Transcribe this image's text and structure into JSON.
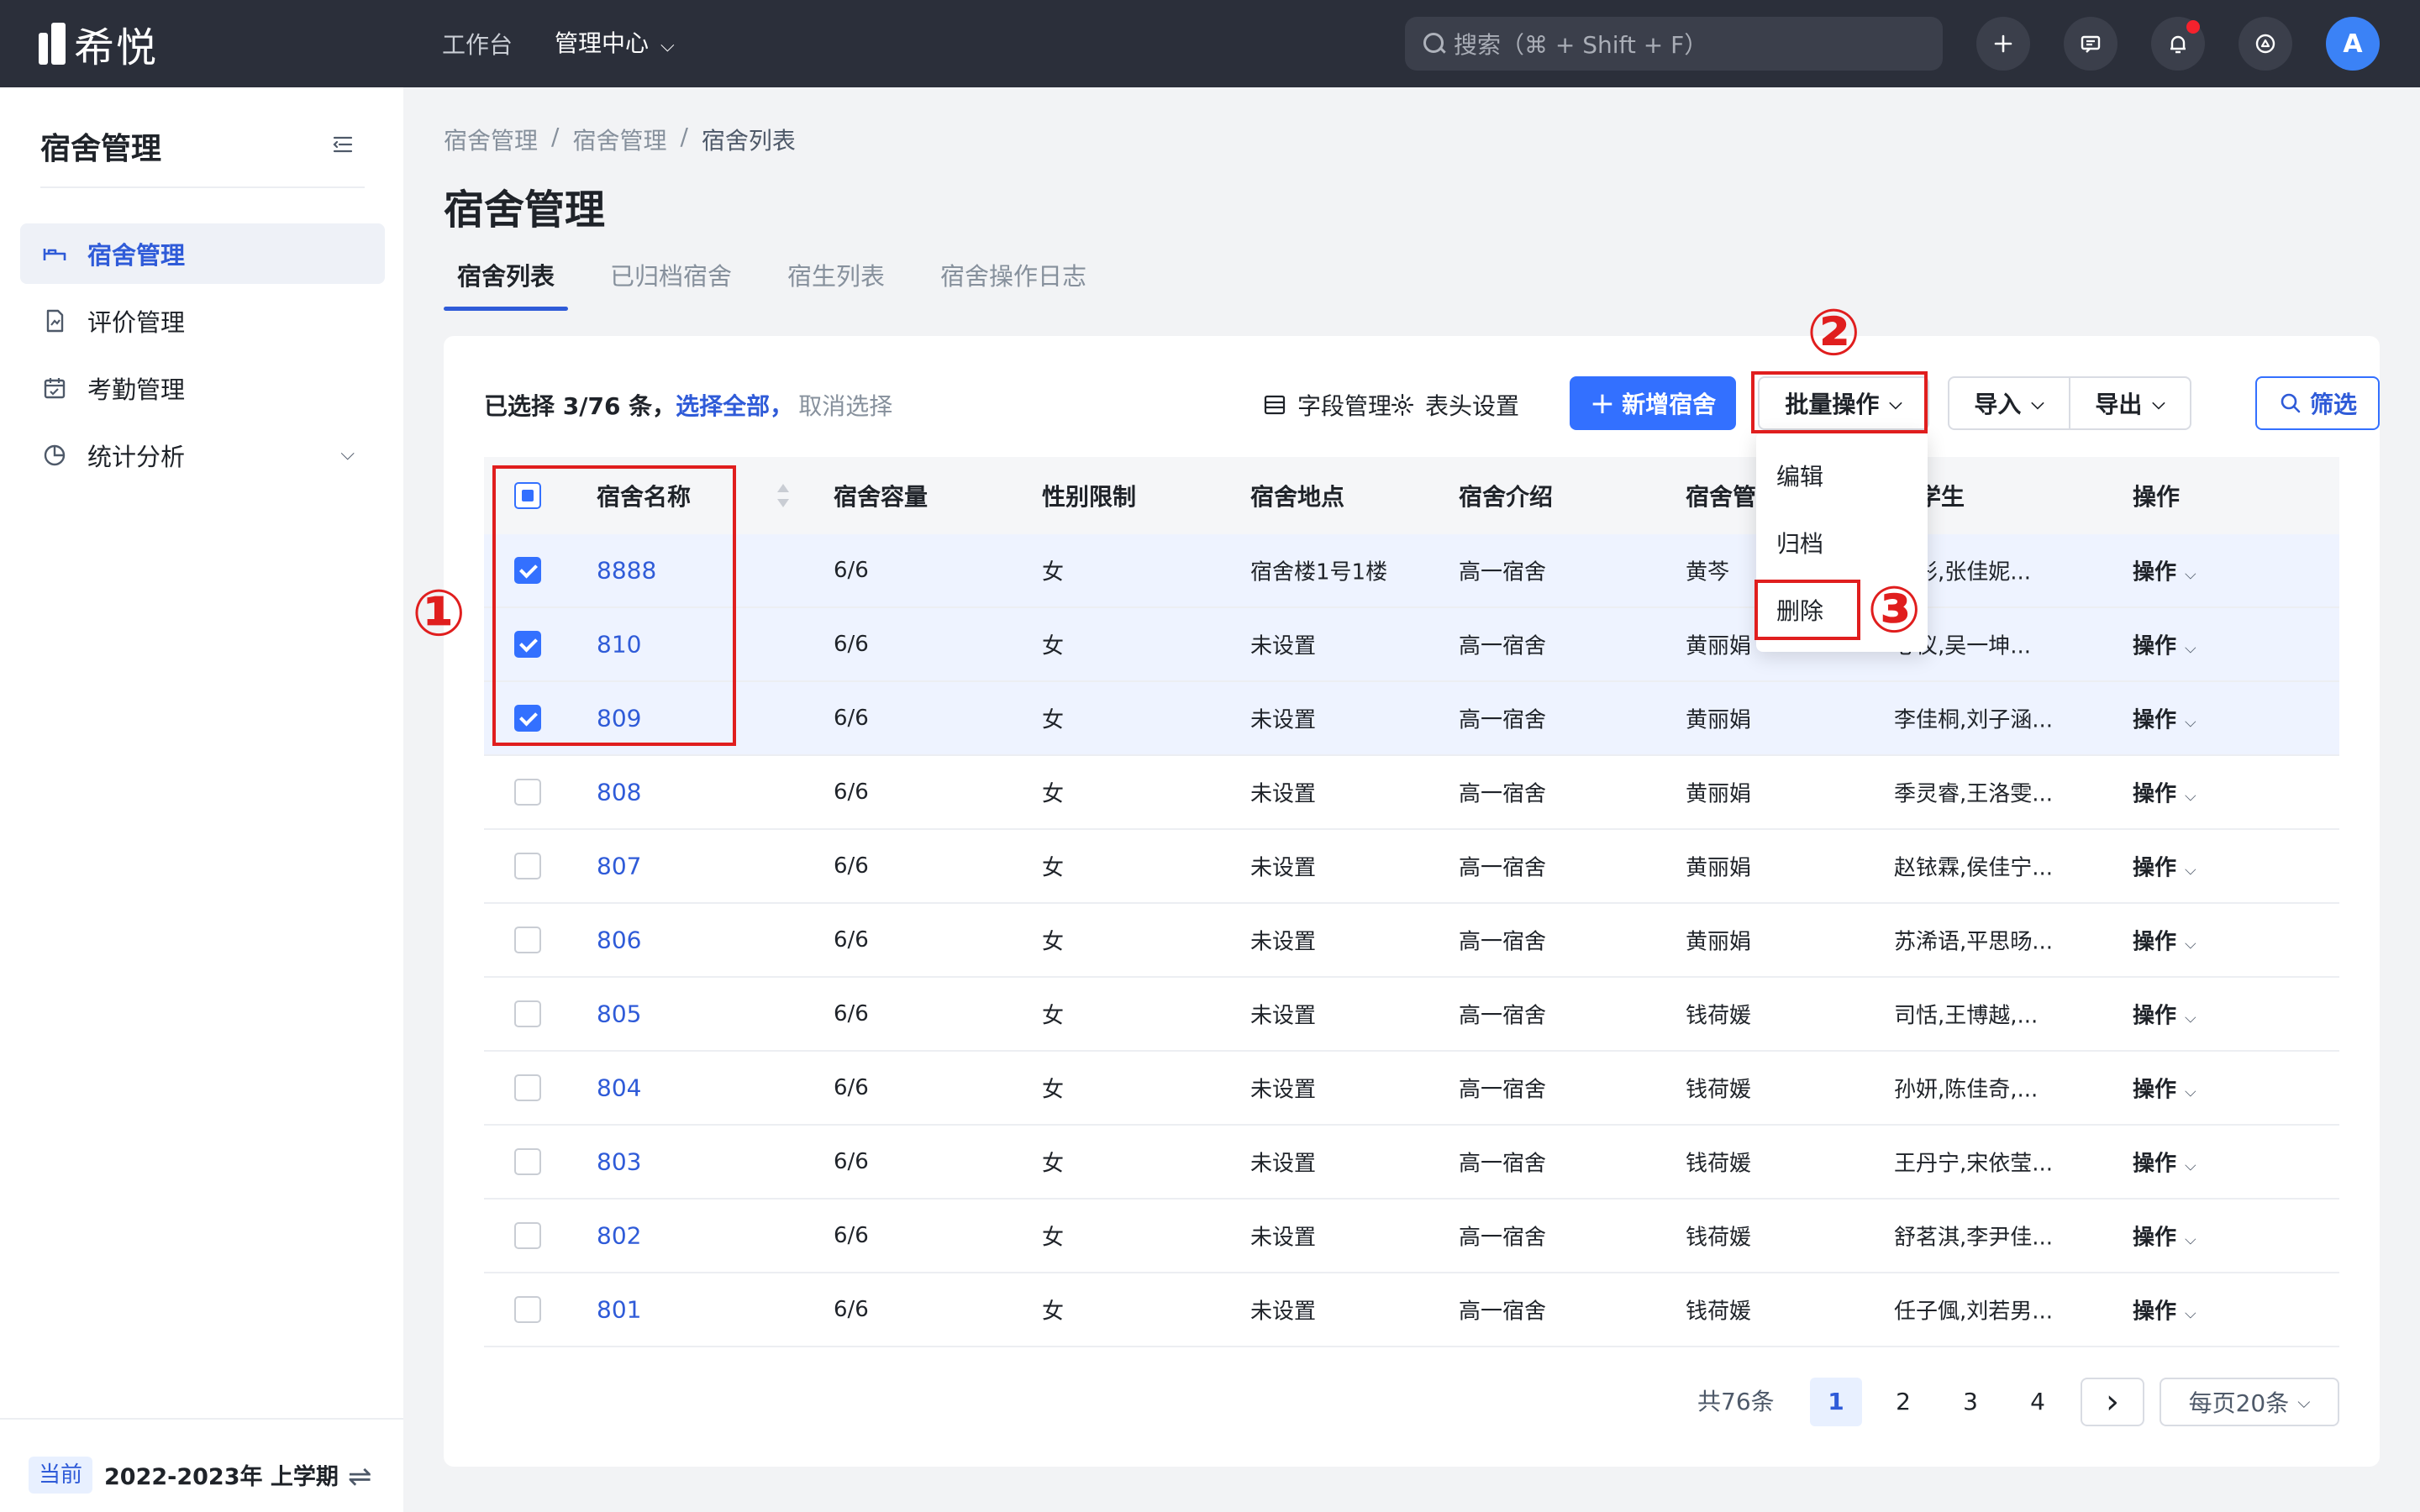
{
  "app": {
    "logo_text": "希悦"
  },
  "topnav": {
    "items": [
      "工作台",
      "管理中心"
    ],
    "chevron": "⌄"
  },
  "search": {
    "placeholder": "搜索（⌘ + Shift + F）"
  },
  "header_icons": [
    "plus-icon",
    "message-icon",
    "bell-icon",
    "help-icon"
  ],
  "user": {
    "avatar": "A"
  },
  "sidebar": {
    "title": "宿舍管理",
    "items": [
      {
        "label": "宿舍管理",
        "icon": "bed-icon"
      },
      {
        "label": "评价管理",
        "icon": "evaluation-icon"
      },
      {
        "label": "考勤管理",
        "icon": "calendar-icon"
      },
      {
        "label": "统计分析",
        "icon": "pie-chart-icon"
      }
    ],
    "term_tag": "当前",
    "term_text": "2022-2023年 上学期"
  },
  "breadcrumb": [
    "宿舍管理",
    "/",
    "宿舍管理",
    "/",
    "宿舍列表"
  ],
  "page_title": "宿舍管理",
  "tabs": [
    "宿舍列表",
    "已归档宿舍",
    "宿生列表",
    "宿舍操作日志"
  ],
  "toolbar": {
    "selection_prefix": "已选择 3/76 条，",
    "select_all": "选择全部，",
    "cancel": "取消选择",
    "field_manage": "字段管理",
    "header_settings": "表头设置",
    "add_plus": "+",
    "add_button": "新增宿舍",
    "batch_button": "批量操作",
    "import_button": "导入",
    "export_button": "导出",
    "filter_button": "筛选"
  },
  "batch_menu": [
    "编辑",
    "归档",
    "删除"
  ],
  "table": {
    "headers": [
      "宿舍名称",
      "宿舍容量",
      "性别限制",
      "宿舍地点",
      "宿舍介绍",
      "宿舍管",
      "舍学生",
      "操作"
    ],
    "rows": [
      {
        "name": "8888",
        "capacity": "6/6",
        "gender": "女",
        "location": "宿舍楼1号1楼",
        "intro": "高一宿舍",
        "manager": "黄芩",
        "students": "思彤,张佳妮...",
        "op": "操作",
        "checked": true
      },
      {
        "name": "810",
        "capacity": "6/6",
        "gender": "女",
        "location": "未设置",
        "intro": "高一宿舍",
        "manager": "黄丽娟",
        "students": "心仪,吴一坤...",
        "op": "操作",
        "checked": true
      },
      {
        "name": "809",
        "capacity": "6/6",
        "gender": "女",
        "location": "未设置",
        "intro": "高一宿舍",
        "manager": "黄丽娟",
        "students": "李佳桐,刘子涵...",
        "op": "操作",
        "checked": true
      },
      {
        "name": "808",
        "capacity": "6/6",
        "gender": "女",
        "location": "未设置",
        "intro": "高一宿舍",
        "manager": "黄丽娟",
        "students": "季灵睿,王洛雯...",
        "op": "操作",
        "checked": false
      },
      {
        "name": "807",
        "capacity": "6/6",
        "gender": "女",
        "location": "未设置",
        "intro": "高一宿舍",
        "manager": "黄丽娟",
        "students": "赵铱霖,侯佳宁...",
        "op": "操作",
        "checked": false
      },
      {
        "name": "806",
        "capacity": "6/6",
        "gender": "女",
        "location": "未设置",
        "intro": "高一宿舍",
        "manager": "黄丽娟",
        "students": "苏浠语,平思旸...",
        "op": "操作",
        "checked": false
      },
      {
        "name": "805",
        "capacity": "6/6",
        "gender": "女",
        "location": "未设置",
        "intro": "高一宿舍",
        "manager": "钱荷媛",
        "students": "司恬,王博越,...",
        "op": "操作",
        "checked": false
      },
      {
        "name": "804",
        "capacity": "6/6",
        "gender": "女",
        "location": "未设置",
        "intro": "高一宿舍",
        "manager": "钱荷媛",
        "students": "孙妍,陈佳奇,...",
        "op": "操作",
        "checked": false
      },
      {
        "name": "803",
        "capacity": "6/6",
        "gender": "女",
        "location": "未设置",
        "intro": "高一宿舍",
        "manager": "钱荷媛",
        "students": "王丹宁,宋依莹...",
        "op": "操作",
        "checked": false
      },
      {
        "name": "802",
        "capacity": "6/6",
        "gender": "女",
        "location": "未设置",
        "intro": "高一宿舍",
        "manager": "钱荷媛",
        "students": "舒茗淇,李尹佳...",
        "op": "操作",
        "checked": false
      },
      {
        "name": "801",
        "capacity": "6/6",
        "gender": "女",
        "location": "未设置",
        "intro": "高一宿舍",
        "manager": "钱荷媛",
        "students": "任子偑,刘若男...",
        "op": "操作",
        "checked": false
      }
    ]
  },
  "pagination": {
    "total": "共76条",
    "pages": [
      "1",
      "2",
      "3",
      "4"
    ],
    "current": "1",
    "next": "›",
    "page_size": "每页20条"
  },
  "annotations": [
    "①",
    "②",
    "③"
  ],
  "colors": {
    "primary": "#3370ff",
    "topbar": "#2b2f3a",
    "annotation": "#e01e1e",
    "selected_row": "#eef3ff"
  }
}
